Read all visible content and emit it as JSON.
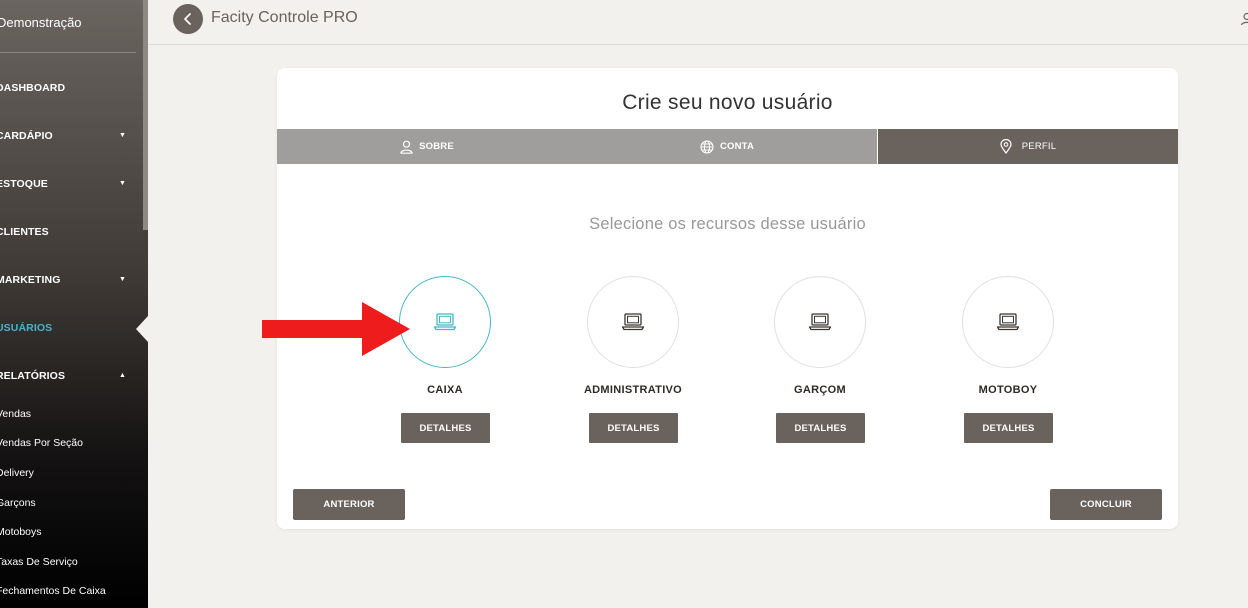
{
  "sidebar": {
    "org_name": "Demonstração",
    "nav": [
      {
        "label": "DASHBOARD",
        "caret": ""
      },
      {
        "label": "CARDÁPIO",
        "caret": "▼"
      },
      {
        "label": "ESTOQUE",
        "caret": "▼"
      },
      {
        "label": "CLIENTES",
        "caret": ""
      },
      {
        "label": "MARKETING",
        "caret": "▼"
      },
      {
        "label": "USUÁRIOS",
        "caret": ""
      },
      {
        "label": "RELATÓRIOS",
        "caret": "▲"
      }
    ],
    "active_item": "USUÁRIOS",
    "sub_items": [
      "Vendas",
      "Vendas Por Seção",
      "Delivery",
      "Garçons",
      "Motoboys",
      "Taxas De Serviço",
      "Fechamentos De Caixa"
    ]
  },
  "header": {
    "title": "Facity Controle PRO",
    "back_icon": "chevron-left-icon",
    "user_icon": "user-icon"
  },
  "card": {
    "title": "Crie seu novo usuário",
    "steps": [
      {
        "label": "SOBRE",
        "icon": "user-icon"
      },
      {
        "label": "CONTA",
        "icon": "globe-icon"
      },
      {
        "label": "PERFIL",
        "icon": "map-pin-icon"
      }
    ],
    "active_step": "PERFIL",
    "subtitle": "Selecione os recursos desse usuário",
    "options": [
      {
        "label": "CAIXA",
        "button": "DETALHES",
        "icon": "laptop-icon",
        "selected": true
      },
      {
        "label": "ADMINISTRATIVO",
        "button": "DETALHES",
        "icon": "laptop-icon",
        "selected": false
      },
      {
        "label": "GARÇOM",
        "button": "DETALHES",
        "icon": "laptop-icon",
        "selected": false
      },
      {
        "label": "MOTOBOY",
        "button": "DETALHES",
        "icon": "laptop-icon",
        "selected": false
      }
    ],
    "prev_button": "ANTERIOR",
    "done_button": "CONCLUIR"
  },
  "colors": {
    "accent": "#45b5cf",
    "primary": "#6a625c",
    "step_inactive": "#a09e9c",
    "annotation_arrow": "#ee1c1c"
  }
}
